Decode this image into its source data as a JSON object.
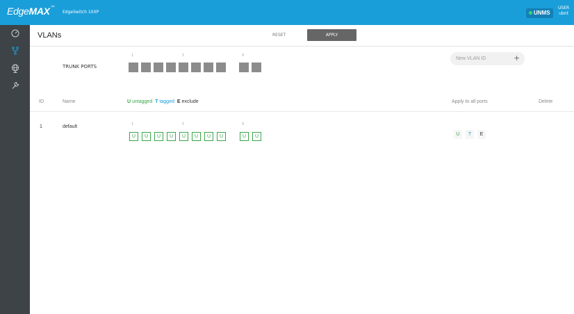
{
  "topbar": {
    "brand_edge": "Edge",
    "brand_max": "MAX",
    "brand_tm": "™",
    "device_name": "EdgeSwitch 10XP",
    "unms_label": "UNMS",
    "user_label": "USER",
    "username": "ubnt",
    "color": "#1a9ed9"
  },
  "sidebar": {
    "items": [
      {
        "icon": "dashboard-gauge-icon"
      },
      {
        "icon": "vlan-network-icon",
        "active": true
      },
      {
        "icon": "globe-icon"
      },
      {
        "icon": "wrench-icon"
      }
    ]
  },
  "header": {
    "title": "VLANs",
    "reset_label": "RESET",
    "apply_label": "APPLY"
  },
  "trunk": {
    "label": "TRUNK PORTS",
    "port_numbers": [
      "1",
      "5",
      "9"
    ],
    "port_count": 10
  },
  "new_vlan": {
    "placeholder": "New VLAN ID",
    "add_label": "+"
  },
  "table": {
    "col_id": "ID",
    "col_name": "Name",
    "legend": {
      "u_key": "U",
      "u_text": "untagged",
      "t_key": "T",
      "t_text": "tagged",
      "e_key": "E",
      "e_text": "exclude"
    },
    "col_apply_all": "Apply to all ports",
    "col_delete": "Delete",
    "rows": [
      {
        "id": "1",
        "name": "default",
        "port_numbers": [
          "1",
          "5",
          "9"
        ],
        "ports": [
          "U",
          "U",
          "U",
          "U",
          "U",
          "U",
          "U",
          "U",
          "U",
          "U"
        ],
        "apply_all": [
          "U",
          "T",
          "E"
        ]
      }
    ]
  }
}
